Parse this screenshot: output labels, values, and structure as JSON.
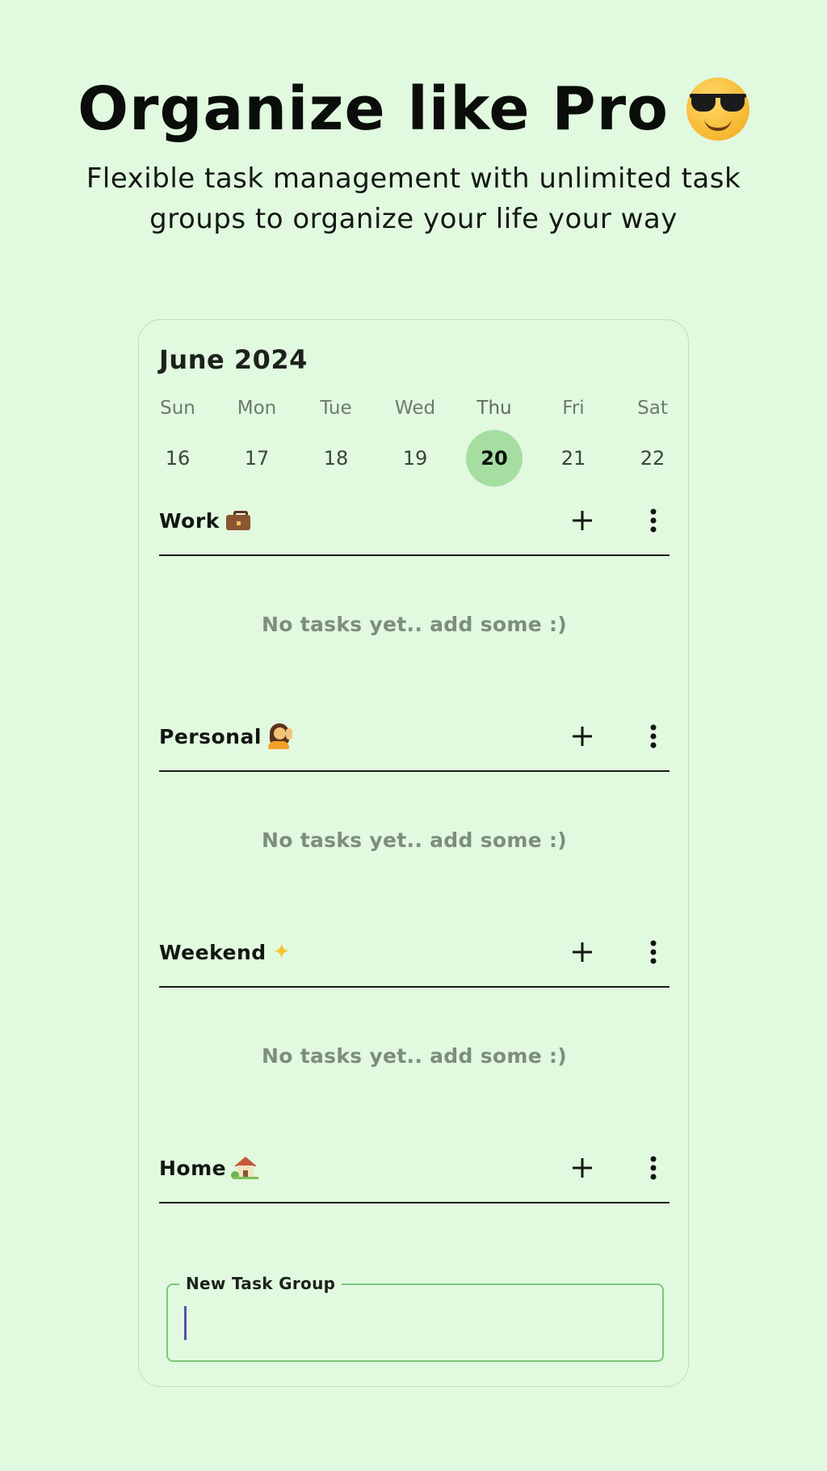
{
  "headline": {
    "title": "Organize like Pro",
    "emoji_icon": "smiling-face-with-sunglasses-icon",
    "subtitle_line1": "Flexible task management with unlimited task",
    "subtitle_line2": "groups to organize your life your way"
  },
  "calendar": {
    "month_label": "June 2024",
    "days": [
      {
        "name": "Sun",
        "num": "16",
        "selected": false
      },
      {
        "name": "Mon",
        "num": "17",
        "selected": false
      },
      {
        "name": "Tue",
        "num": "18",
        "selected": false
      },
      {
        "name": "Wed",
        "num": "19",
        "selected": false
      },
      {
        "name": "Thu",
        "num": "20",
        "selected": true
      },
      {
        "name": "Fri",
        "num": "21",
        "selected": false
      },
      {
        "name": "Sat",
        "num": "22",
        "selected": false
      }
    ],
    "selected_color": "#a6dea2"
  },
  "groups": [
    {
      "title": "Work",
      "icon": "briefcase-icon",
      "empty_text": "No tasks yet.. add some :)"
    },
    {
      "title": "Personal",
      "icon": "person-tipping-hand-icon",
      "empty_text": "No tasks yet.. add some :)"
    },
    {
      "title": "Weekend",
      "icon": "sparkles-icon",
      "empty_text": "No tasks yet.. add some :)"
    },
    {
      "title": "Home",
      "icon": "house-with-garden-icon",
      "empty_text": ""
    }
  ],
  "new_group": {
    "label": "New Task Group",
    "value": ""
  },
  "colors": {
    "background": "#e1f9df",
    "accent_border": "#7ec67a",
    "caret": "#5b4fa8"
  }
}
